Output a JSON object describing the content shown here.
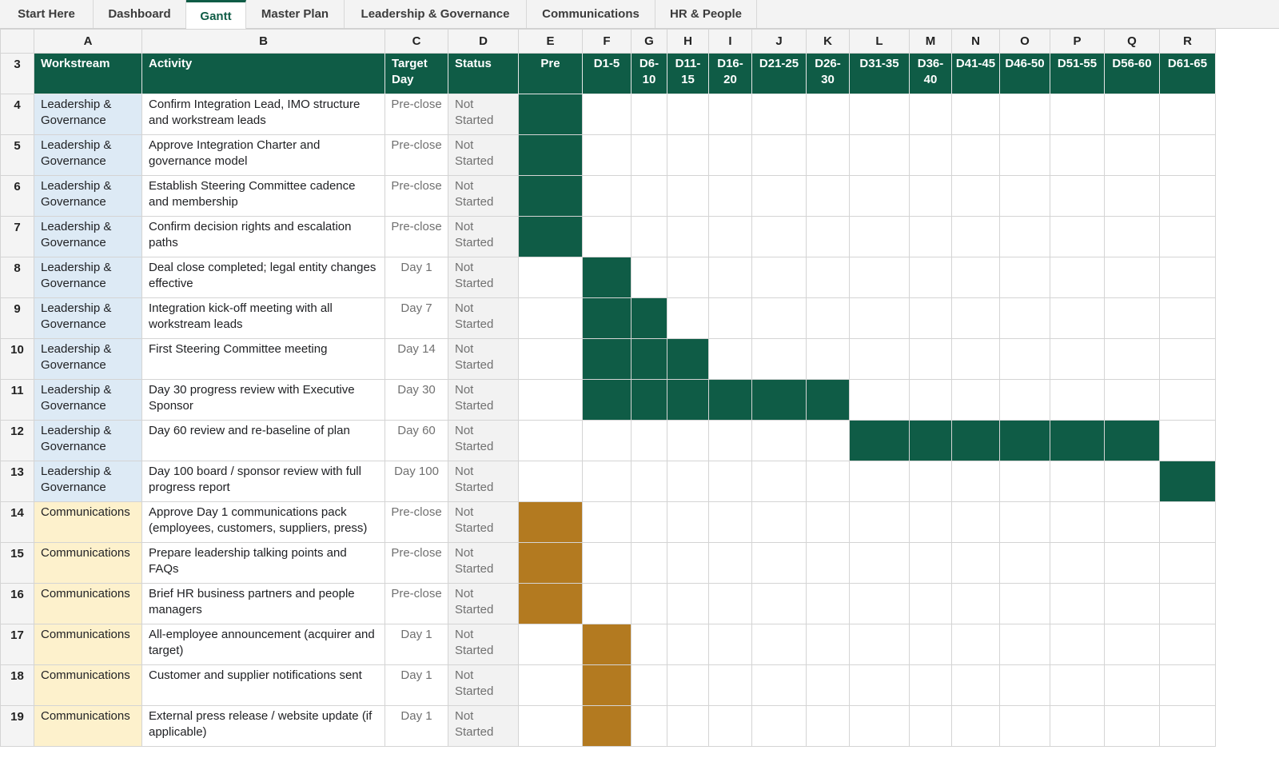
{
  "tabs": [
    {
      "label": "Start Here",
      "active": false
    },
    {
      "label": "Dashboard",
      "active": false
    },
    {
      "label": "Gantt",
      "active": true
    },
    {
      "label": "Master Plan",
      "active": false
    },
    {
      "label": "Leadership & Governance",
      "active": false
    },
    {
      "label": "Communications",
      "active": false
    },
    {
      "label": "HR & People",
      "active": false
    }
  ],
  "column_letters": [
    "A",
    "B",
    "C",
    "D",
    "E",
    "F",
    "G",
    "H",
    "I",
    "J",
    "K",
    "L",
    "M",
    "N",
    "O",
    "P",
    "Q",
    "R"
  ],
  "header_row_number": "3",
  "headers": {
    "workstream": "Workstream",
    "activity": "Activity",
    "target_day": "Target Day",
    "status": "Status",
    "periods": [
      "Pre",
      "D1-5",
      "D6-10",
      "D11-15",
      "D16-20",
      "D21-25",
      "D26-30",
      "D31-35",
      "D36-40",
      "D41-45",
      "D46-50",
      "D51-55",
      "D56-60",
      "D61-65"
    ]
  },
  "colors": {
    "Leadership & Governance": {
      "workstream_bg": "#ddeaf5",
      "bar": "#0f5c46"
    },
    "Communications": {
      "workstream_bg": "#fdf1cc",
      "bar": "#b37a20"
    },
    "header_bg": "#0f5c46"
  },
  "rows": [
    {
      "row": "4",
      "workstream": "Leadership & Governance",
      "activity": "Confirm Integration Lead, IMO structure and workstream leads",
      "target": "Pre-close",
      "status": "Not Started",
      "bars": [
        "Pre"
      ]
    },
    {
      "row": "5",
      "workstream": "Leadership & Governance",
      "activity": "Approve Integration Charter and governance model",
      "target": "Pre-close",
      "status": "Not Started",
      "bars": [
        "Pre"
      ]
    },
    {
      "row": "6",
      "workstream": "Leadership & Governance",
      "activity": "Establish Steering Committee cadence and membership",
      "target": "Pre-close",
      "status": "Not Started",
      "bars": [
        "Pre"
      ]
    },
    {
      "row": "7",
      "workstream": "Leadership & Governance",
      "activity": "Confirm decision rights and escalation paths",
      "target": "Pre-close",
      "status": "Not Started",
      "bars": [
        "Pre"
      ]
    },
    {
      "row": "8",
      "workstream": "Leadership & Governance",
      "activity": "Deal close completed; legal entity changes effective",
      "target": "Day 1",
      "status": "Not Started",
      "bars": [
        "D1-5"
      ]
    },
    {
      "row": "9",
      "workstream": "Leadership & Governance",
      "activity": "Integration kick-off meeting with all workstream leads",
      "target": "Day 7",
      "status": "Not Started",
      "bars": [
        "D1-5",
        "D6-10"
      ]
    },
    {
      "row": "10",
      "workstream": "Leadership & Governance",
      "activity": "First Steering Committee meeting",
      "target": "Day 14",
      "status": "Not Started",
      "bars": [
        "D1-5",
        "D6-10",
        "D11-15"
      ]
    },
    {
      "row": "11",
      "workstream": "Leadership & Governance",
      "activity": "Day 30 progress review with Executive Sponsor",
      "target": "Day 30",
      "status": "Not Started",
      "bars": [
        "D1-5",
        "D6-10",
        "D11-15",
        "D16-20",
        "D21-25",
        "D26-30"
      ]
    },
    {
      "row": "12",
      "workstream": "Leadership & Governance",
      "activity": "Day 60 review and re-baseline of plan",
      "target": "Day 60",
      "status": "Not Started",
      "bars": [
        "D31-35",
        "D36-40",
        "D41-45",
        "D46-50",
        "D51-55",
        "D56-60"
      ]
    },
    {
      "row": "13",
      "workstream": "Leadership & Governance",
      "activity": "Day 100 board / sponsor review with full progress report",
      "target": "Day 100",
      "status": "Not Started",
      "bars": [
        "D61-65"
      ]
    },
    {
      "row": "14",
      "workstream": "Communications",
      "activity": "Approve Day 1 communications pack (employees, customers, suppliers, press)",
      "target": "Pre-close",
      "status": "Not Started",
      "bars": [
        "Pre"
      ]
    },
    {
      "row": "15",
      "workstream": "Communications",
      "activity": "Prepare leadership talking points and FAQs",
      "target": "Pre-close",
      "status": "Not Started",
      "bars": [
        "Pre"
      ]
    },
    {
      "row": "16",
      "workstream": "Communications",
      "activity": "Brief HR business partners and people managers",
      "target": "Pre-close",
      "status": "Not Started",
      "bars": [
        "Pre"
      ]
    },
    {
      "row": "17",
      "workstream": "Communications",
      "activity": "All-employee announcement (acquirer and target)",
      "target": "Day 1",
      "status": "Not Started",
      "bars": [
        "D1-5"
      ]
    },
    {
      "row": "18",
      "workstream": "Communications",
      "activity": "Customer and supplier notifications sent",
      "target": "Day 1",
      "status": "Not Started",
      "bars": [
        "D1-5"
      ]
    },
    {
      "row": "19",
      "workstream": "Communications",
      "activity": "External press release / website update (if applicable)",
      "target": "Day 1",
      "status": "Not Started",
      "bars": [
        "D1-5"
      ]
    }
  ]
}
